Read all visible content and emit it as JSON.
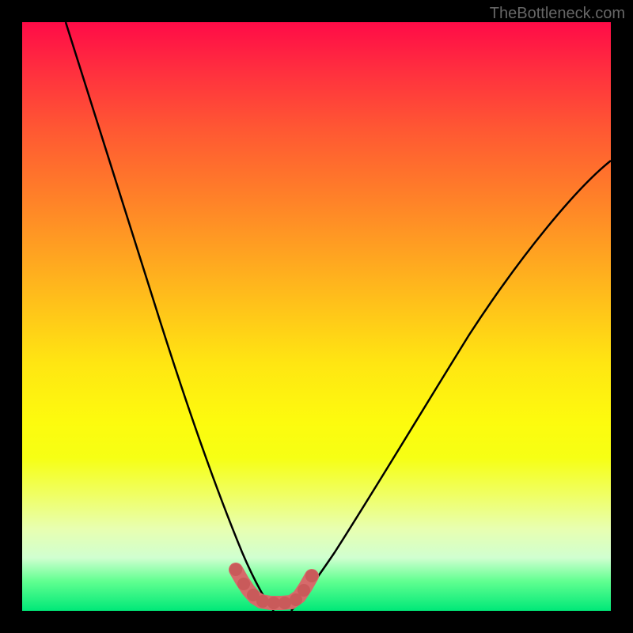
{
  "watermark": "TheBottleneck.com",
  "colors": {
    "background": "#000000",
    "gradient_top": "#ff0b47",
    "gradient_bottom": "#00e878",
    "curve": "#000000",
    "marker": "#d66a6a"
  },
  "chart_data": {
    "type": "line",
    "title": "",
    "xlabel": "",
    "ylabel": "",
    "xlim": [
      0,
      100
    ],
    "ylim": [
      0,
      100
    ],
    "note": "No axis ticks or labels visible. Values are estimated from pixel positions. Two V-shaped curves sharing a common minimum near x≈40, y≈0.",
    "series": [
      {
        "name": "left-curve",
        "x": [
          11,
          14,
          17,
          20,
          23,
          26,
          29,
          32,
          34,
          36,
          38,
          40,
          42
        ],
        "y": [
          100,
          87,
          75,
          63,
          53,
          43,
          33,
          24,
          17,
          11,
          6,
          2,
          0
        ]
      },
      {
        "name": "right-curve",
        "x": [
          44,
          47,
          50,
          55,
          60,
          65,
          70,
          75,
          80,
          85,
          90,
          95,
          100
        ],
        "y": [
          0,
          2,
          5,
          11,
          17,
          24,
          31,
          38,
          45,
          52,
          59,
          66,
          72
        ]
      }
    ],
    "markers": {
      "name": "bottom-bracket",
      "color": "#d66a6a",
      "points": [
        {
          "x": 36,
          "y": 7
        },
        {
          "x": 37,
          "y": 5
        },
        {
          "x": 38,
          "y": 3
        },
        {
          "x": 39,
          "y": 1.5
        },
        {
          "x": 40,
          "y": 1
        },
        {
          "x": 42,
          "y": 1
        },
        {
          "x": 44,
          "y": 1
        },
        {
          "x": 46,
          "y": 1.5
        },
        {
          "x": 47,
          "y": 2.5
        },
        {
          "x": 48,
          "y": 4
        },
        {
          "x": 49,
          "y": 6
        }
      ]
    }
  }
}
